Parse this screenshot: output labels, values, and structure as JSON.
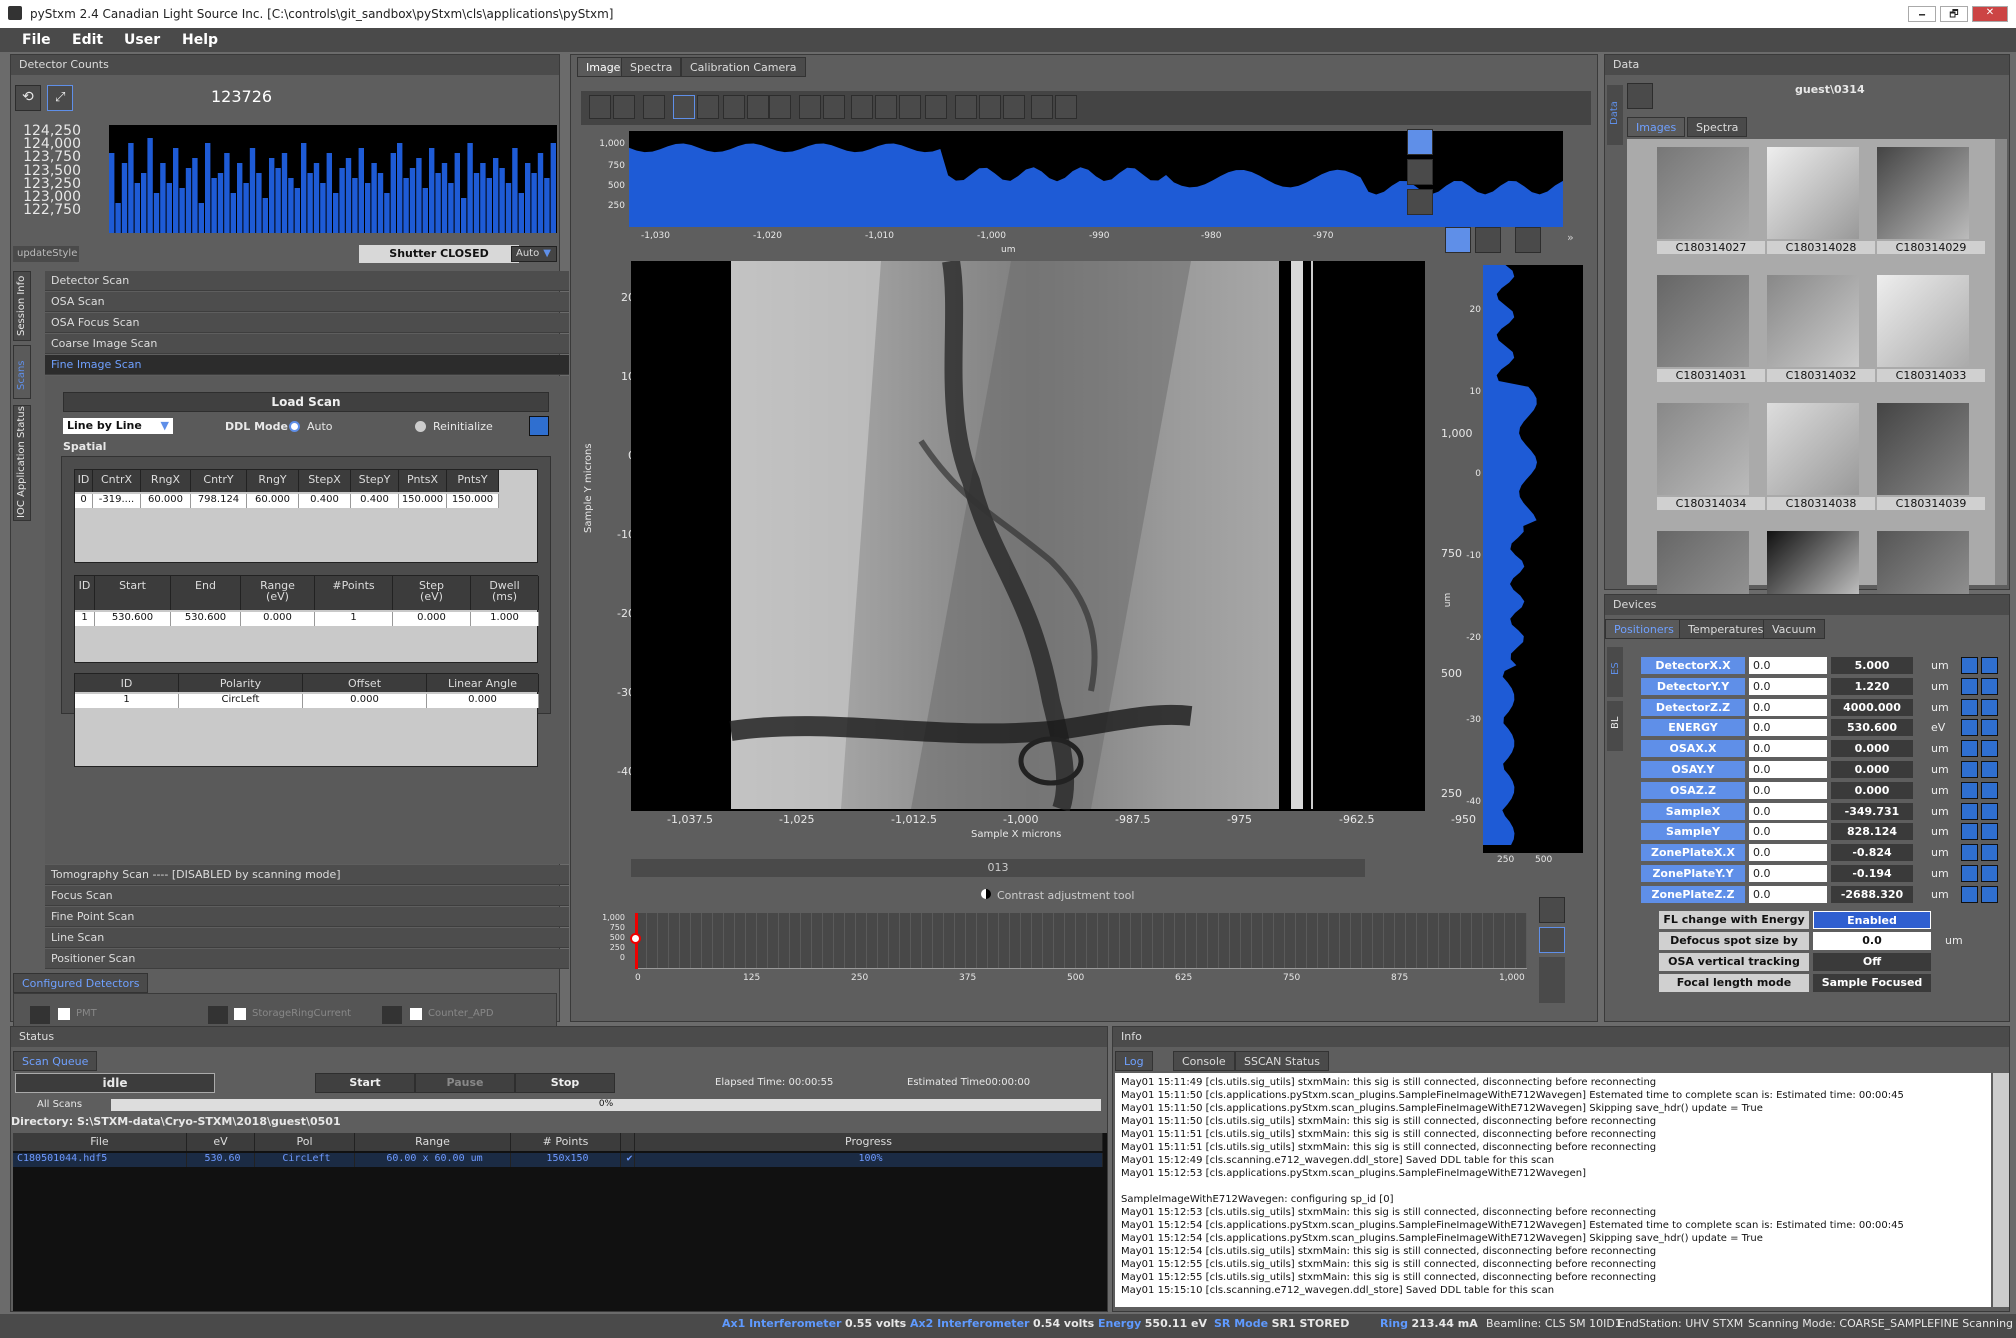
{
  "window": {
    "title": "pyStxm 2.4 Canadian Light Source Inc. [C:\\controls\\git_sandbox\\pyStxm\\cls\\applications\\pyStxm]",
    "controls": [
      "🗕",
      "🗗",
      "✕"
    ]
  },
  "menu": [
    "File",
    "Edit",
    "User",
    "Help"
  ],
  "detector": {
    "header": "Detector Counts",
    "count": "123726",
    "yticks": [
      "124,250",
      "124,000",
      "123,750",
      "123,500",
      "123,250",
      "123,000",
      "122,750"
    ],
    "series": [
      0.8,
      0.3,
      0.7,
      0.9,
      0.5,
      0.6,
      0.95,
      0.4,
      0.7,
      0.5,
      0.85,
      0.45,
      0.65,
      0.75,
      0.3,
      0.9,
      0.55,
      0.6,
      0.8,
      0.4,
      0.7,
      0.5,
      0.85,
      0.6,
      0.35,
      0.75,
      0.65,
      0.8,
      0.55,
      0.45,
      0.9,
      0.6,
      0.7,
      0.5,
      0.8,
      0.4,
      0.65,
      0.75,
      0.55,
      0.85,
      0.5,
      0.7,
      0.6,
      0.4,
      0.8,
      0.9,
      0.55,
      0.65,
      0.75,
      0.45,
      0.85,
      0.6,
      0.7,
      0.5,
      0.8,
      0.35,
      0.9,
      0.6,
      0.7,
      0.55,
      0.75,
      0.65,
      0.5,
      0.85,
      0.4,
      0.7,
      0.6,
      0.8,
      0.55,
      0.9
    ],
    "update_style": "updateStyle",
    "shutter_label": "Shutter",
    "shutter_state": "CLOSED",
    "auto": "Auto"
  },
  "side_tabs": [
    "Session Info",
    "Scans",
    "IOC Application Status"
  ],
  "scans": {
    "top": [
      "Detector Scan",
      "OSA Scan",
      "OSA Focus Scan",
      "Coarse Image Scan",
      "Fine Image Scan"
    ],
    "bottom": [
      "Tomography Scan ---- [DISABLED by scanning mode]",
      "Focus Scan",
      "Fine Point Scan",
      "Line Scan",
      "Positioner Scan"
    ]
  },
  "fine": {
    "load_scan": "Load Scan",
    "mode_select": "Line by Line",
    "ddl_label": "DDL Mode",
    "ddl_auto": "Auto",
    "ddl_reinit": "Reinitialize",
    "spatial": "Spatial",
    "spatial_headers": [
      "ID",
      "CntrX",
      "RngX",
      "CntrY",
      "RngY",
      "StepX",
      "StepY",
      "PntsX",
      "PntsY"
    ],
    "spatial_row": [
      "0",
      "-319....",
      "60.000",
      "798.124",
      "60.000",
      "0.400",
      "0.400",
      "150.000",
      "150.000"
    ],
    "energy_headers": [
      "ID",
      "Start",
      "End",
      "Range\n(eV)",
      "#Points",
      "Step\n(eV)",
      "Dwell\n(ms)"
    ],
    "energy_row": [
      "1",
      "530.600",
      "530.600",
      "0.000",
      "1",
      "0.000",
      "1.000"
    ],
    "pol_headers": [
      "ID",
      "Polarity",
      "Offset",
      "Linear Angle"
    ],
    "pol_row": [
      "1",
      "CircLeft",
      "0.000",
      "0.000"
    ]
  },
  "configured": {
    "header": "Configured Detectors",
    "items": [
      "PMT",
      "StorageRingCurrent",
      "Counter_APD"
    ]
  },
  "center_tabs": [
    "Image",
    "Spectra",
    "Calibration Camera"
  ],
  "plot": {
    "top_yticks": [
      "1,000",
      "750",
      "500",
      "250"
    ],
    "top_xticks": [
      "-1,030",
      "-1,020",
      "-1,010",
      "-1,000",
      "-990",
      "-980",
      "-970"
    ],
    "top_unit": "um",
    "main_xlabel": "Sample X microns",
    "main_ylabel": "Sample Y microns",
    "main_xticks": [
      "-1,037.5",
      "-1,025",
      "-1,012.5",
      "-1,000",
      "-987.5",
      "-975",
      "-962.5",
      "-950"
    ],
    "main_yticks": [
      "20",
      "10",
      "0",
      "-10",
      "-20",
      "-30",
      "-40"
    ],
    "right_ticks": [
      "1,000",
      "750",
      "500",
      "250"
    ],
    "right_unit": "um",
    "side_yticks": [
      "20",
      "10",
      "0",
      "-10",
      "-20",
      "-30",
      "-40"
    ],
    "side_xticks": [
      "250",
      "500"
    ],
    "label_box": "013",
    "contrast": "Contrast adjustment tool",
    "hist_yticks": [
      "1,000",
      "750",
      "500",
      "250",
      "0"
    ],
    "hist_xticks": [
      "0",
      "125",
      "250",
      "375",
      "500",
      "625",
      "750",
      "875",
      "1,000"
    ]
  },
  "data_panel": {
    "header": "Data",
    "side": "Data",
    "user": "guest\\0314",
    "tabs": [
      "Images",
      "Spectra"
    ],
    "thumbs": [
      "C180314027",
      "C180314028",
      "C180314029",
      "C180314031",
      "C180314032",
      "C180314033",
      "C180314034",
      "C180314038",
      "C180314039",
      "",
      "",
      " "
    ]
  },
  "devices": {
    "header": "Devices",
    "tabs": [
      "Positioners",
      "Temperatures",
      "Vacuum"
    ],
    "side": [
      "ES",
      "BL"
    ],
    "rows": [
      {
        "name": "DetectorX.X",
        "set": "0.0",
        "val": "5.000",
        "unit": "um"
      },
      {
        "name": "DetectorY.Y",
        "set": "0.0",
        "val": "1.220",
        "unit": "um"
      },
      {
        "name": "DetectorZ.Z",
        "set": "0.0",
        "val": "4000.000",
        "unit": "um"
      },
      {
        "name": "ENERGY",
        "set": "0.0",
        "val": "530.600",
        "unit": "eV"
      },
      {
        "name": "OSAX.X",
        "set": "0.0",
        "val": "0.000",
        "unit": "um"
      },
      {
        "name": "OSAY.Y",
        "set": "0.0",
        "val": "0.000",
        "unit": "um"
      },
      {
        "name": "OSAZ.Z",
        "set": "0.0",
        "val": "0.000",
        "unit": "um"
      },
      {
        "name": "SampleX",
        "set": "0.0",
        "val": "-349.731",
        "unit": "um"
      },
      {
        "name": "SampleY",
        "set": "0.0",
        "val": "828.124",
        "unit": "um"
      },
      {
        "name": "ZonePlateX.X",
        "set": "0.0",
        "val": "-0.824",
        "unit": "um"
      },
      {
        "name": "ZonePlateY.Y",
        "set": "0.0",
        "val": "-0.194",
        "unit": "um"
      },
      {
        "name": "ZonePlateZ.Z",
        "set": "0.0",
        "val": "-2688.320",
        "unit": "um"
      }
    ],
    "opts": [
      {
        "label": "FL change with Energy",
        "val": "Enabled"
      },
      {
        "label": "Defocus spot size by",
        "val": "0.0",
        "unit": "um"
      },
      {
        "label": "OSA vertical tracking",
        "val": "Off"
      },
      {
        "label": "Focal length mode",
        "val": "Sample Focused"
      }
    ]
  },
  "status": {
    "header": "Status",
    "tab": "Scan Queue",
    "state": "idle",
    "start": "Start",
    "pause": "Pause",
    "stop": "Stop",
    "elapsed": "Elapsed Time: 00:00:55",
    "estimated": "Estimated Time00:00:00",
    "all_scans": "All Scans",
    "pct": "0%",
    "directory": "Directory: S:\\STXM-data\\Cryo-STXM\\2018\\guest\\0501",
    "headers": [
      "File",
      "eV",
      "Pol",
      "Range",
      "# Points",
      "",
      "Progress"
    ],
    "row": [
      "C180501044.hdf5",
      "530.60",
      "CircLeft",
      "60.00 x 60.00 um",
      "150x150",
      "✔",
      "100%"
    ]
  },
  "info": {
    "header": "Info",
    "tabs": [
      "Log",
      "Console",
      "SSCAN Status"
    ],
    "lines": [
      "May01 15:11:49 [cls.utils.sig_utils] stxmMain: this sig is still connected, disconnecting before reconnecting",
      "May01 15:11:50 [cls.applications.pyStxm.scan_plugins.SampleFineImageWithE712Wavegen] Estemated time to complete scan is: Estimated time: 00:00:45",
      "May01 15:11:50 [cls.applications.pyStxm.scan_plugins.SampleFineImageWithE712Wavegen] Skipping save_hdr() update = True",
      "May01 15:11:50 [cls.utils.sig_utils] stxmMain: this sig is still connected, disconnecting before reconnecting",
      "May01 15:11:51 [cls.utils.sig_utils] stxmMain: this sig is still connected, disconnecting before reconnecting",
      "May01 15:11:51 [cls.utils.sig_utils] stxmMain: this sig is still connected, disconnecting before reconnecting",
      "May01 15:12:49 [cls.scanning.e712_wavegen.ddl_store] Saved DDL table for this scan",
      "May01 15:12:53 [cls.applications.pyStxm.scan_plugins.SampleFineImageWithE712Wavegen]",
      "",
      "SampleImageWithE712Wavegen: configuring sp_id [0]",
      "May01 15:12:53 [cls.utils.sig_utils] stxmMain: this sig is still connected, disconnecting before reconnecting",
      "May01 15:12:54 [cls.applications.pyStxm.scan_plugins.SampleFineImageWithE712Wavegen] Estemated time to complete scan is: Estimated time: 00:00:45",
      "May01 15:12:54 [cls.applications.pyStxm.scan_plugins.SampleFineImageWithE712Wavegen] Skipping save_hdr() update = True",
      "May01 15:12:54 [cls.utils.sig_utils] stxmMain: this sig is still connected, disconnecting before reconnecting",
      "May01 15:12:55 [cls.utils.sig_utils] stxmMain: this sig is still connected, disconnecting before reconnecting",
      "May01 15:12:55 [cls.utils.sig_utils] stxmMain: this sig is still connected, disconnecting before reconnecting",
      "May01 15:15:10 [cls.scanning.e712_wavegen.ddl_store] Saved DDL table for this scan"
    ]
  },
  "footer": {
    "ax1_l": "Ax1 Interferometer",
    "ax1_v": "0.55 volts",
    "ax2_l": "Ax2 Interferometer",
    "ax2_v": "0.54 volts",
    "en_l": "Energy",
    "en_v": "550.11 eV",
    "sr_l": "SR Mode",
    "sr_v": "SR1 STORED",
    "ring_l": "Ring",
    "ring_v": "213.44 mA",
    "beamline": "Beamline: CLS SM 10ID1",
    "endstation": "EndStation: UHV STXM",
    "mode": "Scanning Mode: COARSE_SAMPLEFINE Scanning"
  },
  "colors": {
    "accent": "#5f8fe8",
    "plot_blue": "#1e5bd6",
    "bg": "#6b6b6b"
  }
}
